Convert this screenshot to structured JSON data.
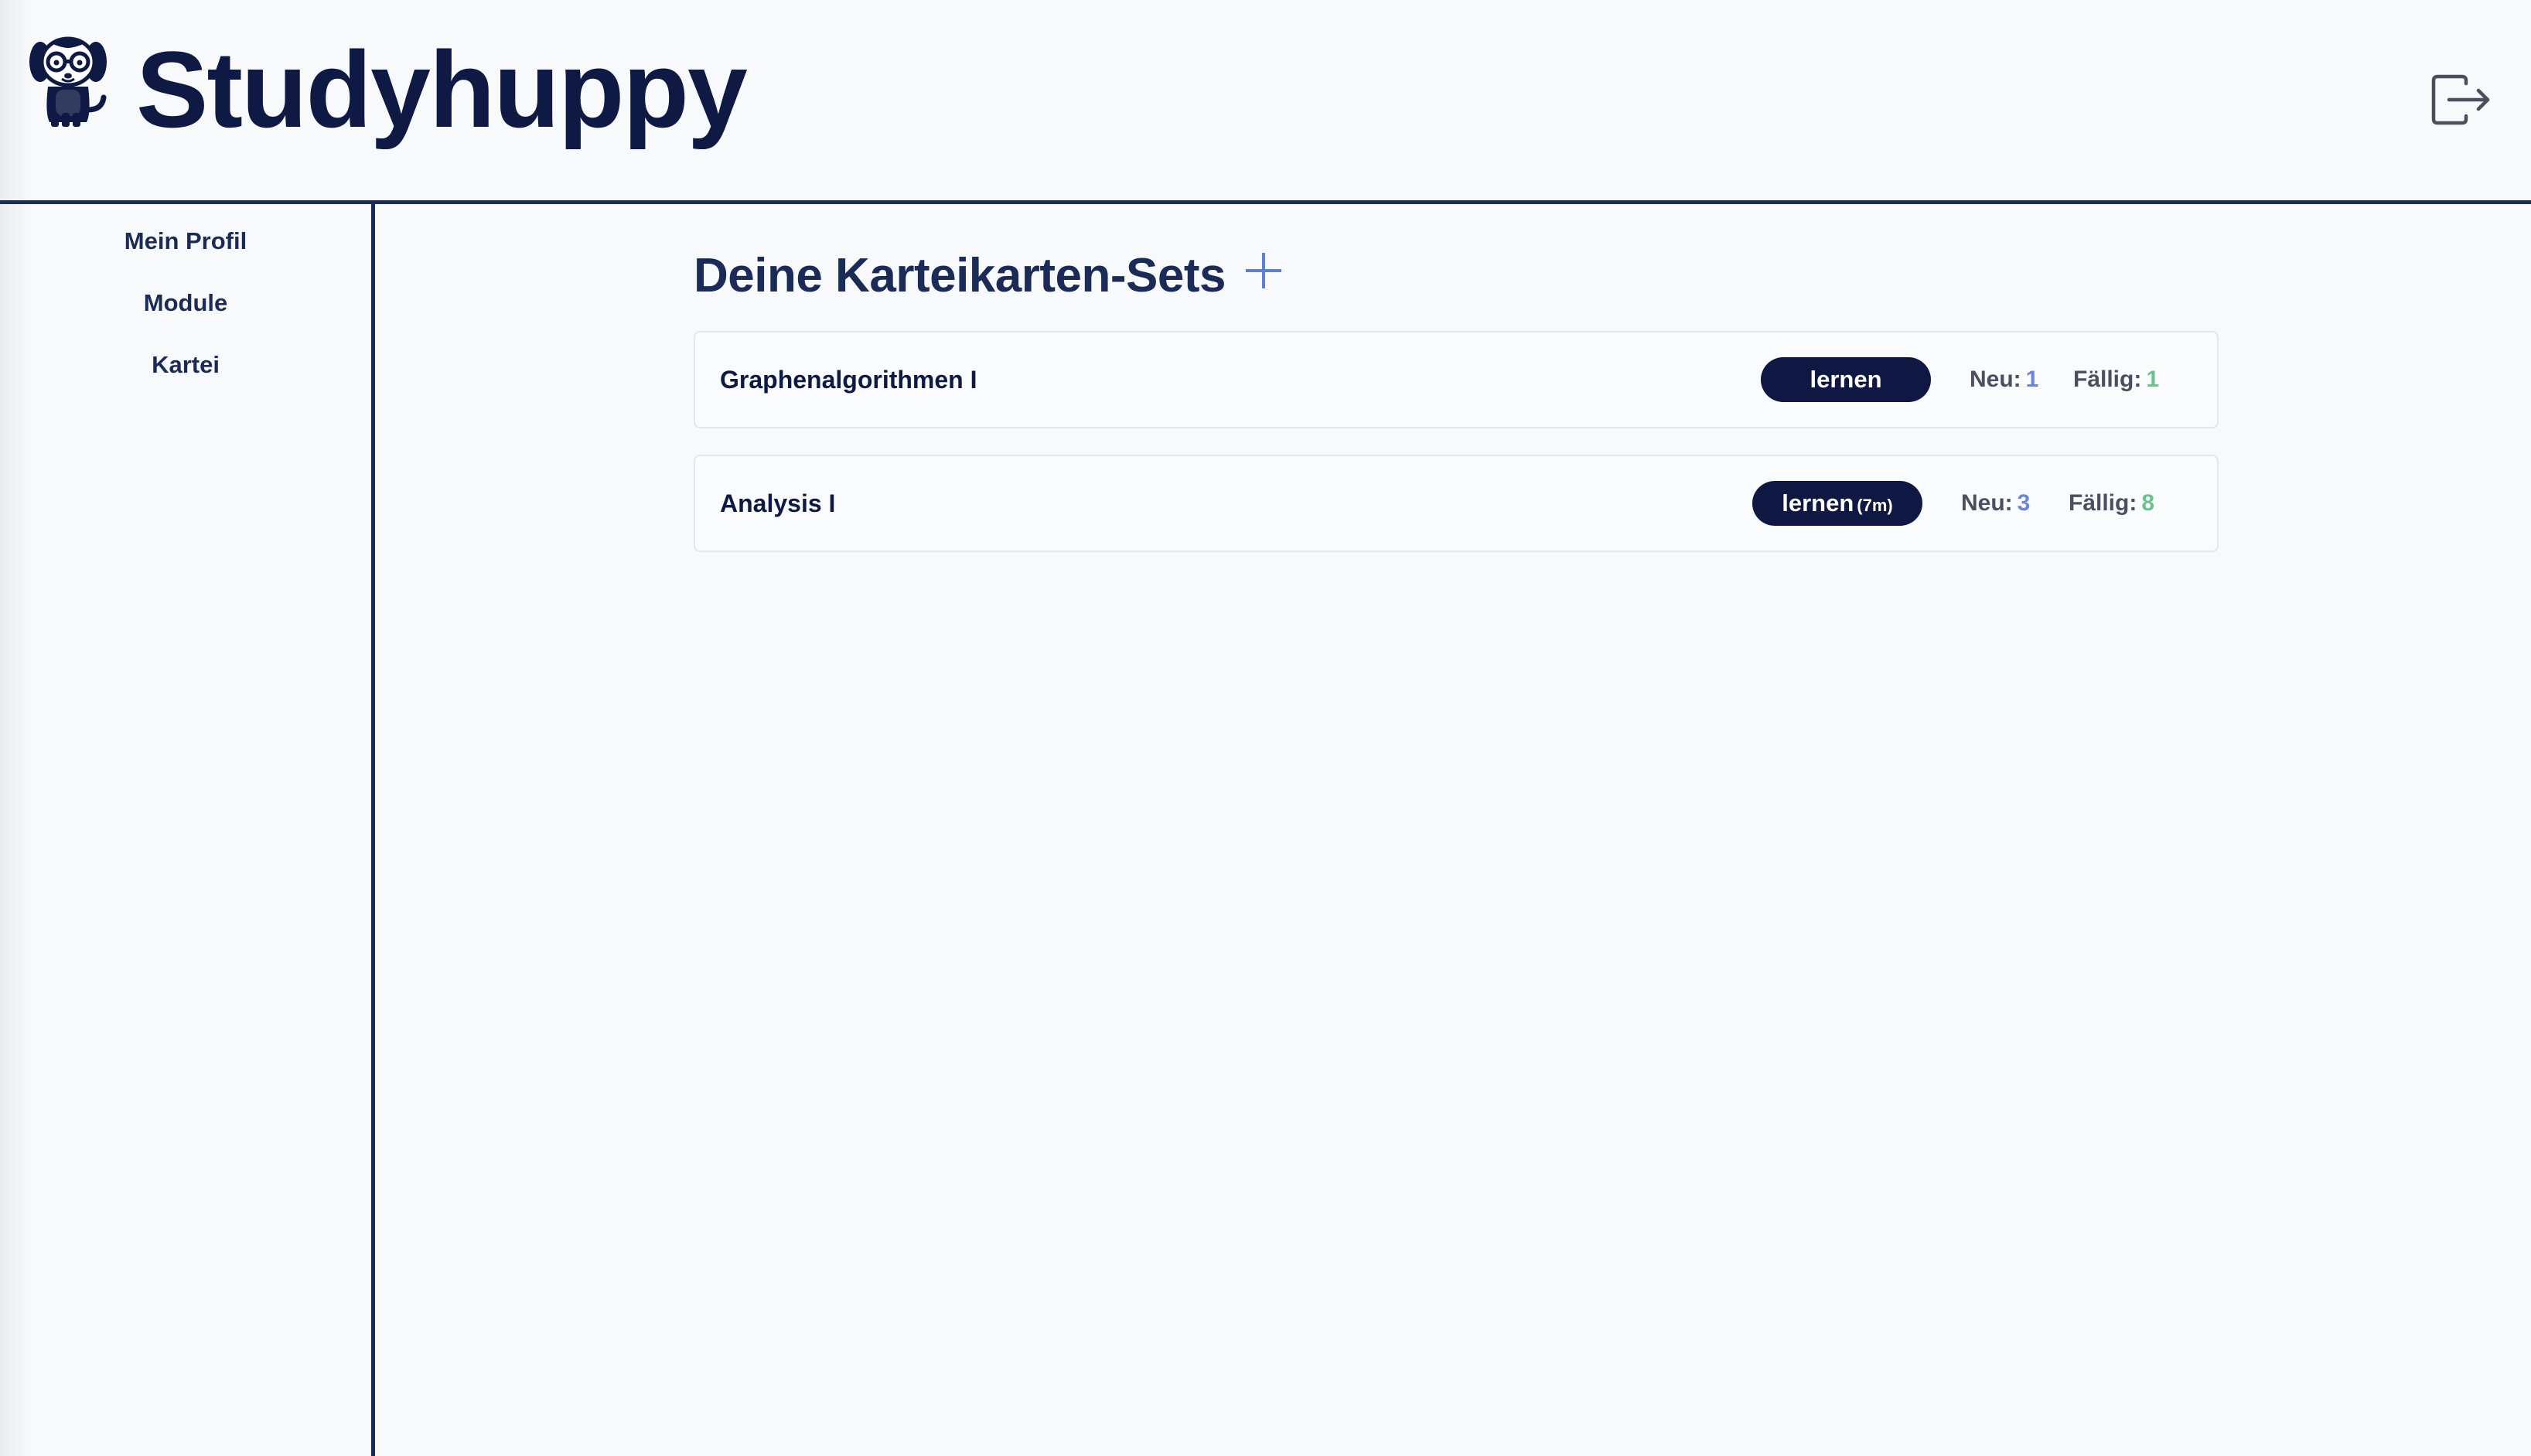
{
  "app": {
    "brand": "Studyhuppy"
  },
  "sidebar": {
    "items": [
      {
        "label": "Mein Profil"
      },
      {
        "label": "Module"
      },
      {
        "label": "Kartei"
      }
    ]
  },
  "main": {
    "title": "Deine Karteikarten-Sets",
    "sets": [
      {
        "name": "Graphenalgorithmen I",
        "learn_label": "lernen",
        "learn_suffix": "",
        "new_label": "Neu:",
        "new_count": "1",
        "due_label": "Fällig:",
        "due_count": "1"
      },
      {
        "name": "Analysis I",
        "learn_label": "lernen",
        "learn_suffix": "(7m)",
        "new_label": "Neu:",
        "new_count": "3",
        "due_label": "Fällig:",
        "due_count": "8"
      }
    ]
  },
  "colors": {
    "navy": "#0e1842",
    "border": "#1b2b57",
    "accent_blue": "#5d7fd1",
    "due_green": "#6cc28e",
    "background": "#f7f9fb"
  },
  "icons": {
    "logo": "dog-with-glasses-icon",
    "logout": "logout-icon",
    "add": "plus-icon"
  }
}
